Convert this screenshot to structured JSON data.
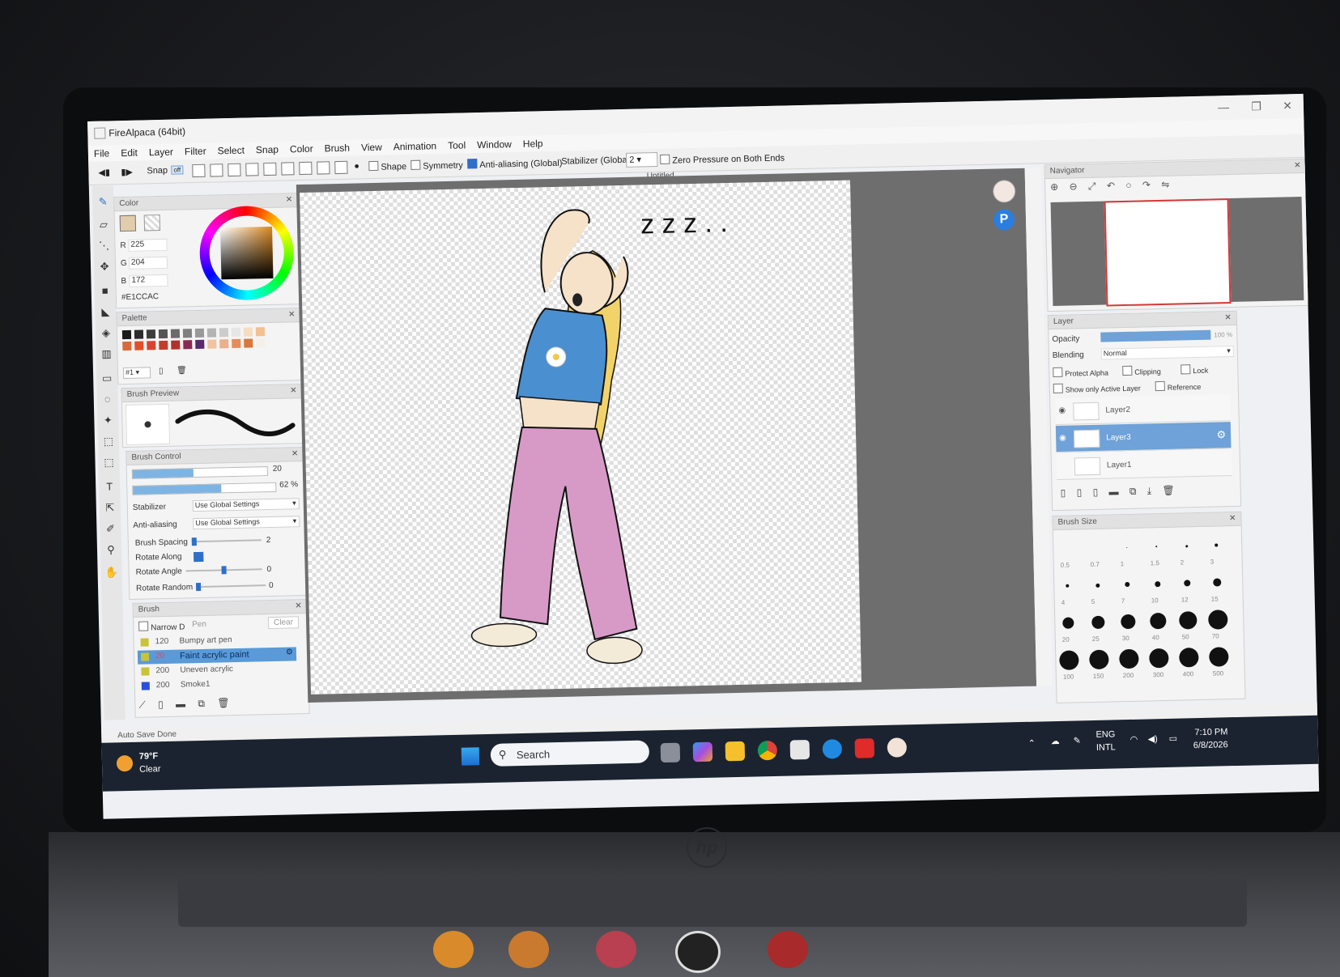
{
  "app": {
    "title": "FireAlpaca (64bit)",
    "menu": [
      "File",
      "Edit",
      "Layer",
      "Filter",
      "Select",
      "Snap",
      "Color",
      "Brush",
      "View",
      "Animation",
      "Tool",
      "Window",
      "Help"
    ]
  },
  "toolbar": {
    "snap_label": "Snap",
    "snap_off": "off",
    "shape_label": "Shape",
    "symmetry_label": "Symmetry",
    "antialias_label": "Anti-aliasing (Global)",
    "stabilizer_label": "Stabilizer (Global)",
    "stabilizer_value": "2",
    "zero_pressure_label": "Zero Pressure on Both Ends"
  },
  "canvas": {
    "title": "Untitled",
    "doodle_text": "z z z . ."
  },
  "color_panel": {
    "title": "Color",
    "r_label": "R",
    "r": "225",
    "g_label": "G",
    "g": "204",
    "b_label": "B",
    "b": "172",
    "hex": "#E1CCAC",
    "current_color": "#e1ccac"
  },
  "palette": {
    "title": "Palette",
    "selector": "#1",
    "colors": [
      "#1a1a1a",
      "#2b2b2b",
      "#3d3d3d",
      "#555",
      "#6b6b6b",
      "#808080",
      "#999",
      "#b3b3b3",
      "#ccc",
      "#e6e6e6",
      "#f5ddc0",
      "#f3c08f",
      "#d96a3c",
      "#e0502b",
      "#d94430",
      "#c43c2c",
      "#b3312c",
      "#8a2a52",
      "#5a2a6e",
      "#f0c4a0",
      "#e9b08b",
      "#e58d5a",
      "#d9773c",
      "#f6efe8"
    ]
  },
  "brush_preview": {
    "title": "Brush Preview"
  },
  "brush_control": {
    "title": "Brush Control",
    "size_value": "20",
    "opacity_value": "62 %",
    "stabilizer_label": "Stabilizer",
    "stabilizer_value": "Use Global Settings",
    "antialias_label": "Anti-aliasing",
    "antialias_value": "Use Global Settings",
    "spacing_label": "Brush Spacing",
    "spacing_value": "2",
    "rotate_along_label": "Rotate Along",
    "rotate_angle_label": "Rotate Angle",
    "rotate_angle_value": "0",
    "rotate_random_label": "Rotate Random",
    "rotate_random_value": "0",
    "size_fraction": 0.45,
    "opacity_fraction": 0.62
  },
  "brush_panel": {
    "title": "Brush",
    "narrow_label": "Narrow D",
    "pen_label": "Pen",
    "clear_label": "Clear",
    "items": [
      {
        "size": "120",
        "name": "Bumpy art pen",
        "color": "#c9c33a"
      },
      {
        "size": "20",
        "name": "Faint acrylic paint",
        "color": "#c9c33a"
      },
      {
        "size": "200",
        "name": "Uneven acrylic",
        "color": "#c9c33a"
      },
      {
        "size": "200",
        "name": "Smoke1",
        "color": "#2a4fd6"
      }
    ]
  },
  "navigator": {
    "title": "Navigator"
  },
  "layer_panel": {
    "title": "Layer",
    "opacity_label": "Opacity",
    "opacity_value": "100 %",
    "blending_label": "Blending",
    "blending_value": "Normal",
    "protect_alpha": "Protect Alpha",
    "clipping": "Clipping",
    "lock": "Lock",
    "show_only_active": "Show only Active Layer",
    "reference": "Reference",
    "layers": [
      "Layer2",
      "Layer3",
      "Layer1"
    ]
  },
  "brush_size": {
    "title": "Brush Size",
    "labels_row1": [
      "0.5",
      "0.7",
      "1",
      "1.5",
      "2",
      "3"
    ],
    "labels_row2": [
      "4",
      "5",
      "7",
      "10",
      "12",
      "15"
    ],
    "labels_row3": [
      "20",
      "25",
      "30",
      "40",
      "50",
      "70"
    ],
    "labels_row4": [
      "100",
      "150",
      "200",
      "300",
      "400",
      "500"
    ]
  },
  "status": {
    "text": "Auto Save Done"
  },
  "taskbar": {
    "weather_temp": "79°F",
    "weather_desc": "Clear",
    "search_placeholder": "Search",
    "lang": "ENG",
    "lang2": "INTL",
    "time": "7:10 PM",
    "date": "6/8/2026"
  }
}
